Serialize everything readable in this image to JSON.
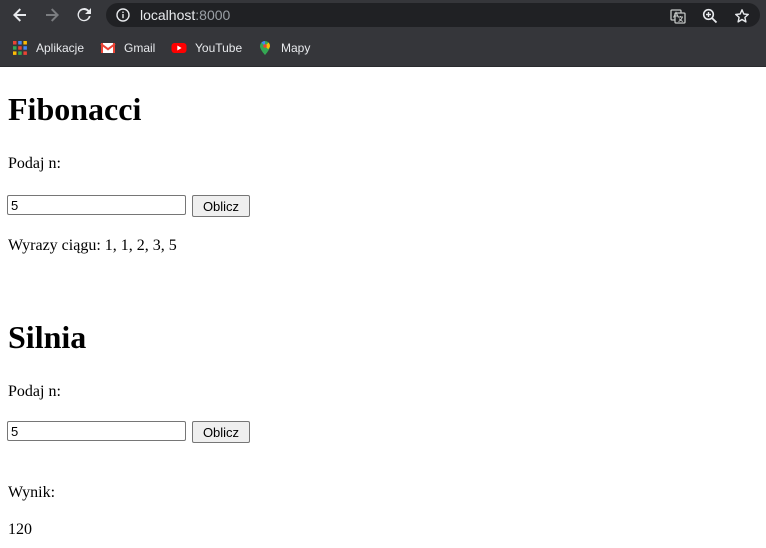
{
  "browser": {
    "url_host": "localhost",
    "url_port": ":8000",
    "bookmarks": [
      {
        "label": "Aplikacje",
        "icon": "apps-grid-icon"
      },
      {
        "label": "Gmail",
        "icon": "gmail-icon"
      },
      {
        "label": "YouTube",
        "icon": "youtube-icon"
      },
      {
        "label": "Mapy",
        "icon": "maps-pin-icon"
      }
    ]
  },
  "fibonacci": {
    "title": "Fibonacci",
    "prompt": "Podaj n:",
    "input_value": "5",
    "button_label": "Oblicz",
    "result": "Wyrazy ciągu: 1, 1, 2, 3, 5"
  },
  "silnia": {
    "title": "Silnia",
    "prompt": "Podaj n:",
    "input_value": "5",
    "button_label": "Oblicz",
    "result_label": "Wynik:",
    "result_value": "120"
  }
}
